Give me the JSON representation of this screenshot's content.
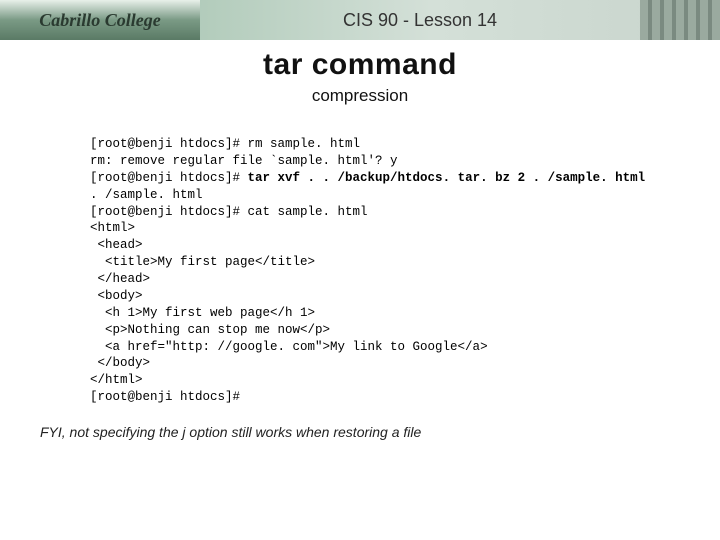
{
  "header": {
    "logoText": "Cabrillo College",
    "course": "CIS 90 - Lesson 14"
  },
  "title": "tar command",
  "subtitle": "compression",
  "terminal": {
    "lines": [
      "[root@benji htdocs]# rm sample. html",
      "rm: remove regular file `sample. html'? y",
      "[root@benji htdocs]# ",
      ". /sample. html",
      "[root@benji htdocs]# cat sample. html",
      "<html>",
      " <head>",
      "  <title>My first page</title>",
      " </head>",
      " <body>",
      "  <h 1>My first web page</h 1>",
      "  <p>Nothing can stop me now</p>",
      "  <a href=\"http: //google. com\">My link to Google</a>",
      " </body>",
      "</html>",
      "[root@benji htdocs]#"
    ],
    "boldCmd": "tar xvf . . /backup/htdocs. tar. bz 2 . /sample. html"
  },
  "footerNote": "FYI, not specifying the j option still works when restoring a file"
}
